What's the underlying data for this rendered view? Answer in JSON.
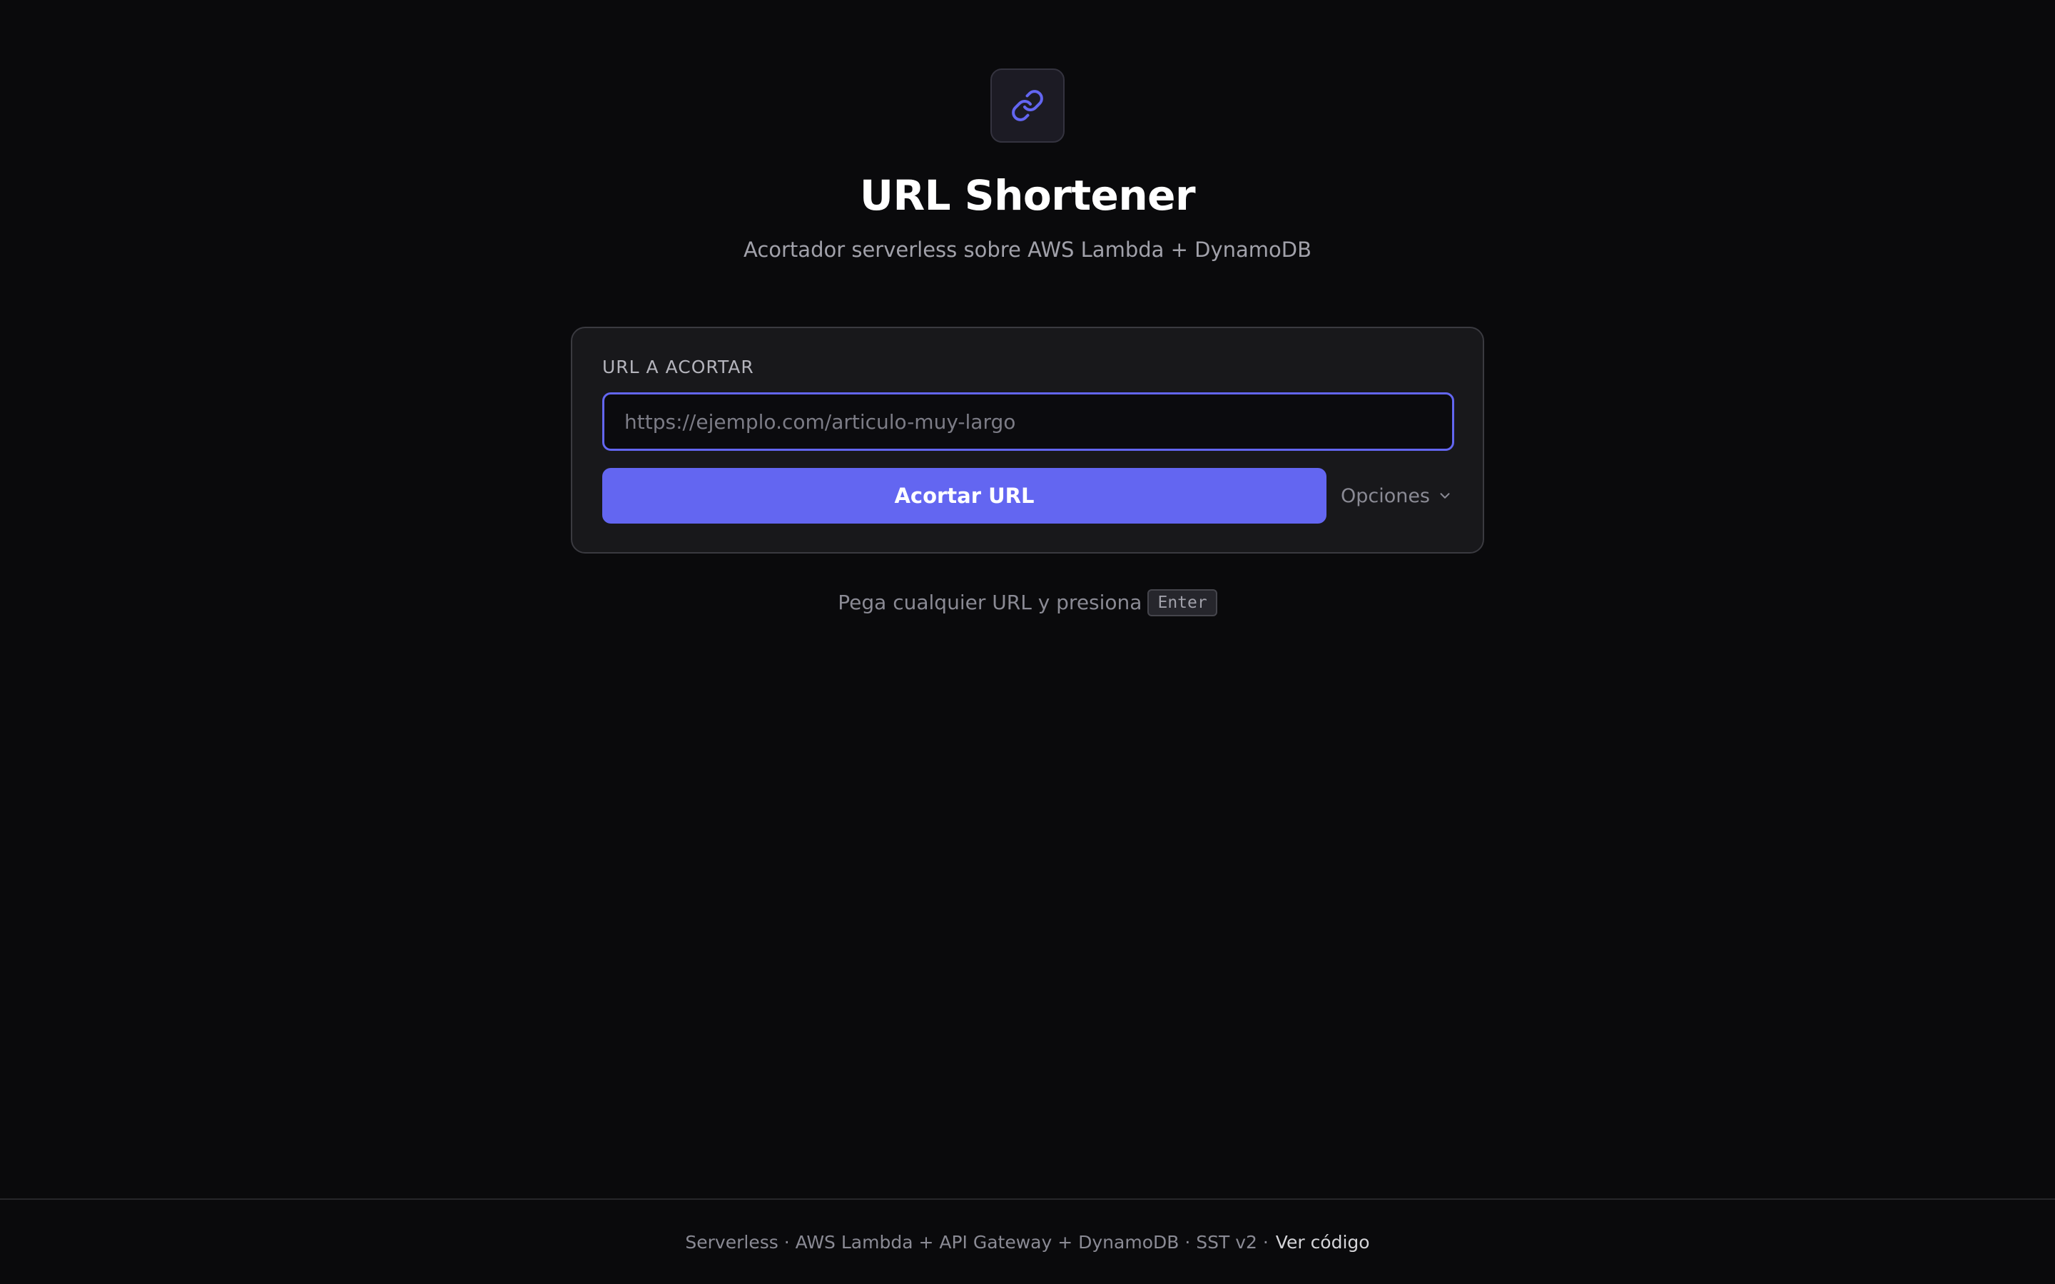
{
  "app": {
    "title": "URL Shortener",
    "subtitle": "Acortador serverless sobre AWS Lambda + DynamoDB",
    "logo_icon": "link-icon",
    "accent_color": "#6366f1"
  },
  "form": {
    "label": "URL A ACORTAR",
    "input_value": "",
    "input_placeholder": "https://ejemplo.com/articulo-muy-largo",
    "submit_label": "Acortar URL",
    "options_label": "Opciones",
    "options_icon": "chevron-down-icon"
  },
  "hint": {
    "text": "Pega cualquier URL y presiona",
    "key": "Enter"
  },
  "footer": {
    "text": "Serverless · AWS Lambda + API Gateway + DynamoDB · SST v2 ·",
    "link_label": "Ver código"
  }
}
